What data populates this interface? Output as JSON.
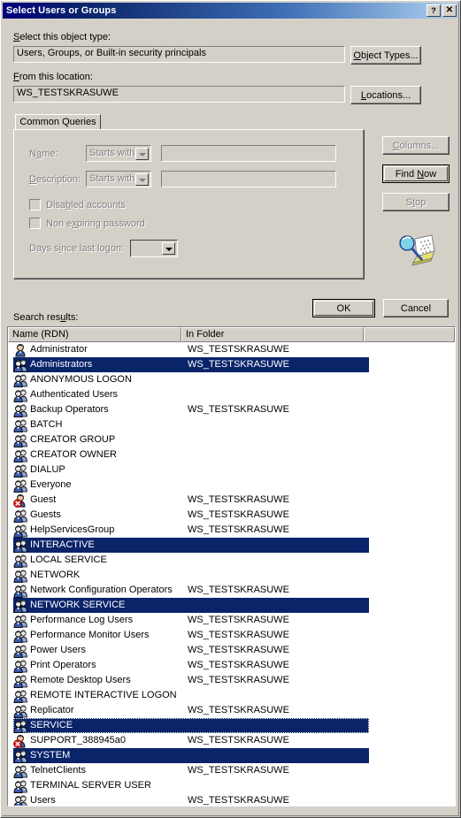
{
  "window": {
    "title": "Select Users or Groups",
    "help_button": "?",
    "close_button": "✕"
  },
  "object_type": {
    "label": "Select this object type:",
    "label_accel": "S",
    "value": "Users, Groups, or Built-in security principals",
    "button": "Object Types...",
    "button_accel": "O"
  },
  "location": {
    "label": "From this location:",
    "label_accel": "F",
    "value": "WS_TESTSKRASUWE",
    "button": "Locations...",
    "button_accel": "L"
  },
  "tabs": [
    {
      "label": "Common Queries",
      "active": true
    }
  ],
  "query": {
    "name_label": "Name:",
    "name_accel": "a",
    "name_operator": "Starts with",
    "name_value": "",
    "description_label": "Description:",
    "description_accel": "D",
    "description_operator": "Starts with",
    "description_value": "",
    "disabled_accounts_label": "Disabled accounts",
    "disabled_accounts_accel": "b",
    "disabled_accounts_checked": false,
    "non_expiring_label": "Non expiring password",
    "non_expiring_accel": "x",
    "non_expiring_checked": false,
    "days_label": "Days since last logon:",
    "days_accel": "i",
    "days_value": ""
  },
  "side_buttons": {
    "columns": "Columns...",
    "columns_accel": "C",
    "columns_enabled": false,
    "find_now": "Find Now",
    "find_now_accel": "N",
    "find_now_enabled": true,
    "stop": "Stop",
    "stop_accel": "t",
    "stop_enabled": false
  },
  "dialog_buttons": {
    "ok": "OK",
    "cancel": "Cancel"
  },
  "results": {
    "label": "Search results:",
    "label_accel": "u",
    "columns": [
      "Name (RDN)",
      "In Folder",
      ""
    ],
    "rows": [
      {
        "name": "Administrator",
        "folder": "WS_TESTSKRASUWE",
        "icon": "user-icon",
        "selected": false
      },
      {
        "name": "Administrators",
        "folder": "WS_TESTSKRASUWE",
        "icon": "group-icon",
        "selected": true
      },
      {
        "name": "ANONYMOUS LOGON",
        "folder": "",
        "icon": "group-icon",
        "selected": false
      },
      {
        "name": "Authenticated Users",
        "folder": "",
        "icon": "group-icon",
        "selected": false
      },
      {
        "name": "Backup Operators",
        "folder": "WS_TESTSKRASUWE",
        "icon": "group-icon",
        "selected": false
      },
      {
        "name": "BATCH",
        "folder": "",
        "icon": "group-icon",
        "selected": false
      },
      {
        "name": "CREATOR GROUP",
        "folder": "",
        "icon": "group-icon",
        "selected": false
      },
      {
        "name": "CREATOR OWNER",
        "folder": "",
        "icon": "group-icon",
        "selected": false
      },
      {
        "name": "DIALUP",
        "folder": "",
        "icon": "group-icon",
        "selected": false
      },
      {
        "name": "Everyone",
        "folder": "",
        "icon": "group-icon",
        "selected": false
      },
      {
        "name": "Guest",
        "folder": "WS_TESTSKRASUWE",
        "icon": "disabled-user-icon",
        "selected": false
      },
      {
        "name": "Guests",
        "folder": "WS_TESTSKRASUWE",
        "icon": "group-icon",
        "selected": false
      },
      {
        "name": "HelpServicesGroup",
        "folder": "WS_TESTSKRASUWE",
        "icon": "group-icon",
        "selected": false
      },
      {
        "name": "INTERACTIVE",
        "folder": "",
        "icon": "group-icon",
        "selected": true
      },
      {
        "name": "LOCAL SERVICE",
        "folder": "",
        "icon": "group-icon",
        "selected": false
      },
      {
        "name": "NETWORK",
        "folder": "",
        "icon": "group-icon",
        "selected": false
      },
      {
        "name": "Network Configuration Operators",
        "folder": "WS_TESTSKRASUWE",
        "icon": "group-icon",
        "selected": false
      },
      {
        "name": "NETWORK SERVICE",
        "folder": "",
        "icon": "group-icon",
        "selected": true
      },
      {
        "name": "Performance Log Users",
        "folder": "WS_TESTSKRASUWE",
        "icon": "group-icon",
        "selected": false
      },
      {
        "name": "Performance Monitor Users",
        "folder": "WS_TESTSKRASUWE",
        "icon": "group-icon",
        "selected": false
      },
      {
        "name": "Power Users",
        "folder": "WS_TESTSKRASUWE",
        "icon": "group-icon",
        "selected": false
      },
      {
        "name": "Print Operators",
        "folder": "WS_TESTSKRASUWE",
        "icon": "group-icon",
        "selected": false
      },
      {
        "name": "Remote Desktop Users",
        "folder": "WS_TESTSKRASUWE",
        "icon": "group-icon",
        "selected": false
      },
      {
        "name": "REMOTE INTERACTIVE LOGON",
        "folder": "",
        "icon": "group-icon",
        "selected": false
      },
      {
        "name": "Replicator",
        "folder": "WS_TESTSKRASUWE",
        "icon": "group-icon",
        "selected": false
      },
      {
        "name": "SERVICE",
        "folder": "",
        "icon": "group-icon",
        "selected": true,
        "focused": true
      },
      {
        "name": "SUPPORT_388945a0",
        "folder": "WS_TESTSKRASUWE",
        "icon": "disabled-user-icon",
        "selected": false
      },
      {
        "name": "SYSTEM",
        "folder": "",
        "icon": "group-icon",
        "selected": true
      },
      {
        "name": "TelnetClients",
        "folder": "WS_TESTSKRASUWE",
        "icon": "group-icon",
        "selected": false
      },
      {
        "name": "TERMINAL SERVER USER",
        "folder": "",
        "icon": "group-icon",
        "selected": false
      },
      {
        "name": "Users",
        "folder": "WS_TESTSKRASUWE",
        "icon": "group-icon",
        "selected": false
      }
    ]
  },
  "icons": {
    "find_icon": "find-search-icon"
  },
  "colors": {
    "dialog_face": "#d4d0c8",
    "title_active_start": "#00007b",
    "title_active_end": "#b5d0ee",
    "selection": "#0a246a",
    "disabled_text": "#808080",
    "window_bg": "#ffffff"
  }
}
